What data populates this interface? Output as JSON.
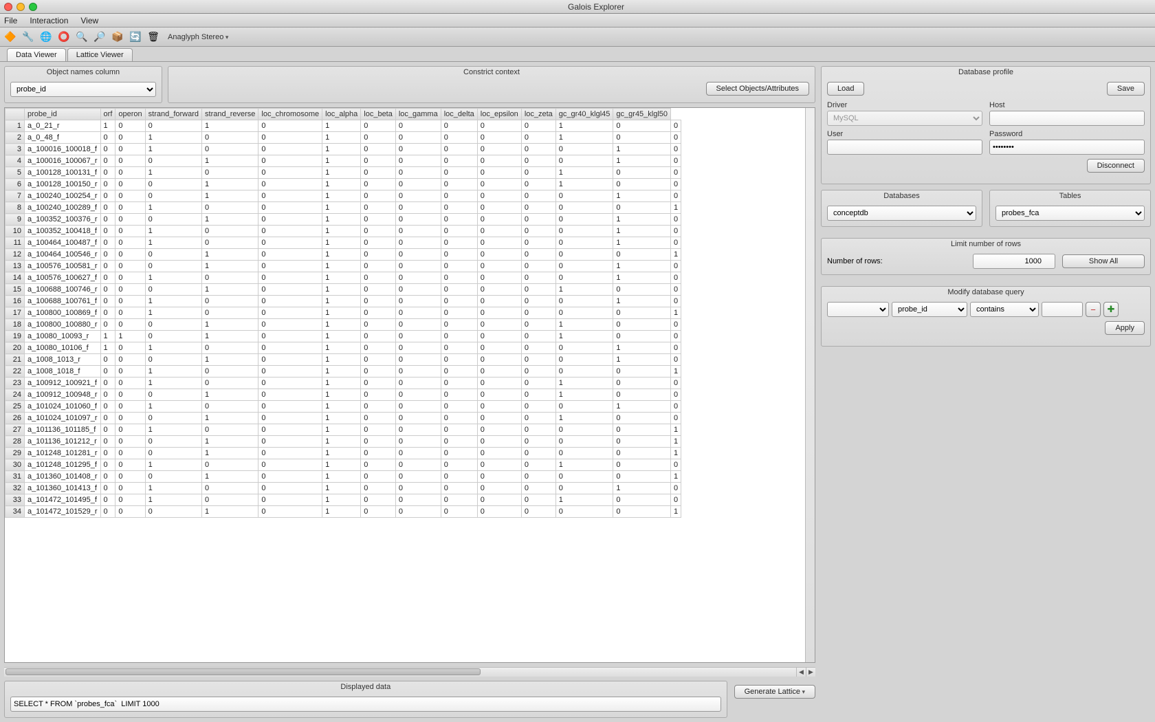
{
  "window": {
    "title": "Galois Explorer"
  },
  "menu": {
    "file": "File",
    "interaction": "Interaction",
    "view": "View"
  },
  "toolbar": {
    "stereo_label": "Anaglyph Stereo"
  },
  "tabs": {
    "data_viewer": "Data Viewer",
    "lattice_viewer": "Lattice Viewer"
  },
  "object_names": {
    "legend": "Object names column",
    "selected": "probe_id"
  },
  "constrict": {
    "legend": "Constrict context",
    "select_btn": "Select Objects/Attributes"
  },
  "table": {
    "columns": [
      "probe_id",
      "orf",
      "operon",
      "strand_forward",
      "strand_reverse",
      "loc_chromosome",
      "loc_alpha",
      "loc_beta",
      "loc_gamma",
      "loc_delta",
      "loc_epsilon",
      "loc_zeta",
      "gc_gr40_klgl45",
      "gc_gr45_klgl50"
    ],
    "rows": [
      [
        "a_0_21_r",
        "1",
        "0",
        "0",
        "1",
        "0",
        "1",
        "0",
        "0",
        "0",
        "0",
        "0",
        "1",
        "0",
        "0"
      ],
      [
        "a_0_48_f",
        "0",
        "0",
        "1",
        "0",
        "0",
        "1",
        "0",
        "0",
        "0",
        "0",
        "0",
        "1",
        "0",
        "0"
      ],
      [
        "a_100016_100018_f",
        "0",
        "0",
        "1",
        "0",
        "0",
        "1",
        "0",
        "0",
        "0",
        "0",
        "0",
        "0",
        "1",
        "0"
      ],
      [
        "a_100016_100067_r",
        "0",
        "0",
        "0",
        "1",
        "0",
        "1",
        "0",
        "0",
        "0",
        "0",
        "0",
        "0",
        "1",
        "0"
      ],
      [
        "a_100128_100131_f",
        "0",
        "0",
        "1",
        "0",
        "0",
        "1",
        "0",
        "0",
        "0",
        "0",
        "0",
        "1",
        "0",
        "0"
      ],
      [
        "a_100128_100150_r",
        "0",
        "0",
        "0",
        "1",
        "0",
        "1",
        "0",
        "0",
        "0",
        "0",
        "0",
        "1",
        "0",
        "0"
      ],
      [
        "a_100240_100254_r",
        "0",
        "0",
        "0",
        "1",
        "0",
        "1",
        "0",
        "0",
        "0",
        "0",
        "0",
        "0",
        "1",
        "0"
      ],
      [
        "a_100240_100289_f",
        "0",
        "0",
        "1",
        "0",
        "0",
        "1",
        "0",
        "0",
        "0",
        "0",
        "0",
        "0",
        "0",
        "1"
      ],
      [
        "a_100352_100376_r",
        "0",
        "0",
        "0",
        "1",
        "0",
        "1",
        "0",
        "0",
        "0",
        "0",
        "0",
        "0",
        "1",
        "0"
      ],
      [
        "a_100352_100418_f",
        "0",
        "0",
        "1",
        "0",
        "0",
        "1",
        "0",
        "0",
        "0",
        "0",
        "0",
        "0",
        "1",
        "0"
      ],
      [
        "a_100464_100487_f",
        "0",
        "0",
        "1",
        "0",
        "0",
        "1",
        "0",
        "0",
        "0",
        "0",
        "0",
        "0",
        "1",
        "0"
      ],
      [
        "a_100464_100546_r",
        "0",
        "0",
        "0",
        "1",
        "0",
        "1",
        "0",
        "0",
        "0",
        "0",
        "0",
        "0",
        "0",
        "1"
      ],
      [
        "a_100576_100581_r",
        "0",
        "0",
        "0",
        "1",
        "0",
        "1",
        "0",
        "0",
        "0",
        "0",
        "0",
        "0",
        "1",
        "0"
      ],
      [
        "a_100576_100627_f",
        "0",
        "0",
        "1",
        "0",
        "0",
        "1",
        "0",
        "0",
        "0",
        "0",
        "0",
        "0",
        "1",
        "0"
      ],
      [
        "a_100688_100746_r",
        "0",
        "0",
        "0",
        "1",
        "0",
        "1",
        "0",
        "0",
        "0",
        "0",
        "0",
        "1",
        "0",
        "0"
      ],
      [
        "a_100688_100761_f",
        "0",
        "0",
        "1",
        "0",
        "0",
        "1",
        "0",
        "0",
        "0",
        "0",
        "0",
        "0",
        "1",
        "0"
      ],
      [
        "a_100800_100869_f",
        "0",
        "0",
        "1",
        "0",
        "0",
        "1",
        "0",
        "0",
        "0",
        "0",
        "0",
        "0",
        "0",
        "1"
      ],
      [
        "a_100800_100880_r",
        "0",
        "0",
        "0",
        "1",
        "0",
        "1",
        "0",
        "0",
        "0",
        "0",
        "0",
        "1",
        "0",
        "0"
      ],
      [
        "a_10080_10093_r",
        "1",
        "1",
        "0",
        "1",
        "0",
        "1",
        "0",
        "0",
        "0",
        "0",
        "0",
        "1",
        "0",
        "0"
      ],
      [
        "a_10080_10106_f",
        "1",
        "0",
        "1",
        "0",
        "0",
        "1",
        "0",
        "0",
        "0",
        "0",
        "0",
        "0",
        "1",
        "0"
      ],
      [
        "a_1008_1013_r",
        "0",
        "0",
        "0",
        "1",
        "0",
        "1",
        "0",
        "0",
        "0",
        "0",
        "0",
        "0",
        "1",
        "0"
      ],
      [
        "a_1008_1018_f",
        "0",
        "0",
        "1",
        "0",
        "0",
        "1",
        "0",
        "0",
        "0",
        "0",
        "0",
        "0",
        "0",
        "1"
      ],
      [
        "a_100912_100921_f",
        "0",
        "0",
        "1",
        "0",
        "0",
        "1",
        "0",
        "0",
        "0",
        "0",
        "0",
        "1",
        "0",
        "0"
      ],
      [
        "a_100912_100948_r",
        "0",
        "0",
        "0",
        "1",
        "0",
        "1",
        "0",
        "0",
        "0",
        "0",
        "0",
        "1",
        "0",
        "0"
      ],
      [
        "a_101024_101060_f",
        "0",
        "0",
        "1",
        "0",
        "0",
        "1",
        "0",
        "0",
        "0",
        "0",
        "0",
        "0",
        "1",
        "0"
      ],
      [
        "a_101024_101097_r",
        "0",
        "0",
        "0",
        "1",
        "0",
        "1",
        "0",
        "0",
        "0",
        "0",
        "0",
        "1",
        "0",
        "0"
      ],
      [
        "a_101136_101185_f",
        "0",
        "0",
        "1",
        "0",
        "0",
        "1",
        "0",
        "0",
        "0",
        "0",
        "0",
        "0",
        "0",
        "1"
      ],
      [
        "a_101136_101212_r",
        "0",
        "0",
        "0",
        "1",
        "0",
        "1",
        "0",
        "0",
        "0",
        "0",
        "0",
        "0",
        "0",
        "1"
      ],
      [
        "a_101248_101281_r",
        "0",
        "0",
        "0",
        "1",
        "0",
        "1",
        "0",
        "0",
        "0",
        "0",
        "0",
        "0",
        "0",
        "1"
      ],
      [
        "a_101248_101295_f",
        "0",
        "0",
        "1",
        "0",
        "0",
        "1",
        "0",
        "0",
        "0",
        "0",
        "0",
        "1",
        "0",
        "0"
      ],
      [
        "a_101360_101408_r",
        "0",
        "0",
        "0",
        "1",
        "0",
        "1",
        "0",
        "0",
        "0",
        "0",
        "0",
        "0",
        "0",
        "1"
      ],
      [
        "a_101360_101413_f",
        "0",
        "0",
        "1",
        "0",
        "0",
        "1",
        "0",
        "0",
        "0",
        "0",
        "0",
        "0",
        "1",
        "0"
      ],
      [
        "a_101472_101495_f",
        "0",
        "0",
        "1",
        "0",
        "0",
        "1",
        "0",
        "0",
        "0",
        "0",
        "0",
        "1",
        "0",
        "0"
      ],
      [
        "a_101472_101529_r",
        "0",
        "0",
        "0",
        "1",
        "0",
        "1",
        "0",
        "0",
        "0",
        "0",
        "0",
        "0",
        "0",
        "1"
      ]
    ]
  },
  "displayed": {
    "legend": "Displayed data",
    "query": "SELECT * FROM `probes_fca`  LIMIT 1000"
  },
  "generate_lattice": "Generate Lattice",
  "db_profile": {
    "legend": "Database profile",
    "load": "Load",
    "save": "Save",
    "driver_label": "Driver",
    "driver_value": "MySQL",
    "host_label": "Host",
    "host_value": "",
    "user_label": "User",
    "user_value": "",
    "password_label": "Password",
    "password_value": "••••••••",
    "disconnect": "Disconnect"
  },
  "databases": {
    "legend": "Databases",
    "selected": "conceptdb"
  },
  "tables_panel": {
    "legend": "Tables",
    "selected": "probes_fca"
  },
  "limit": {
    "legend": "Limit number of rows",
    "label": "Number of rows:",
    "value": "1000",
    "show_all": "Show All"
  },
  "modify": {
    "legend": "Modify database query",
    "field": "probe_id",
    "op": "contains",
    "value": "",
    "apply": "Apply"
  }
}
